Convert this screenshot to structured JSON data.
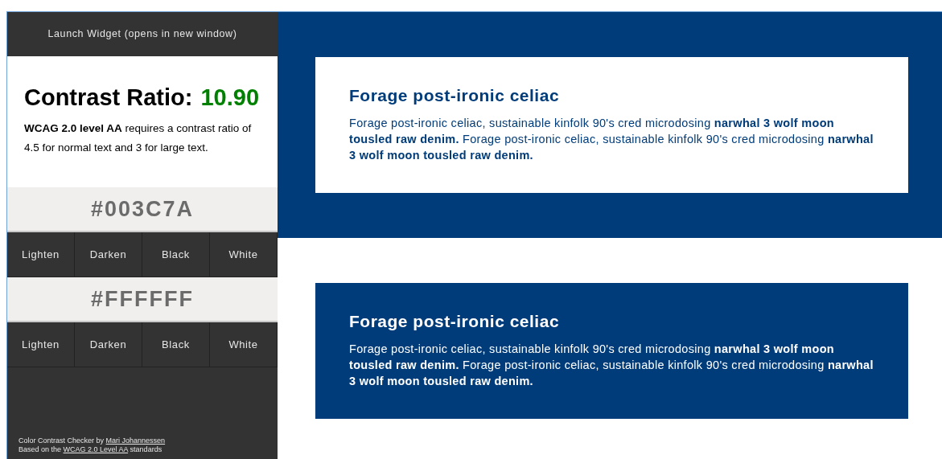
{
  "launch_button": "Launch Widget (opens in new window)",
  "ratio": {
    "label": "Contrast Ratio:",
    "value": "10.90"
  },
  "note": "**WCAG 2.0 level AA** requires a contrast ratio of 4.5 for normal text and 3 for large text.",
  "colors": [
    {
      "hex": "#003C7A",
      "buttons": [
        "Lighten",
        "Darken",
        "Black",
        "White"
      ]
    },
    {
      "hex": "#FFFFFF",
      "buttons": [
        "Lighten",
        "Darken",
        "Black",
        "White"
      ]
    }
  ],
  "footer": [
    {
      "before": "Color Contrast Checker by",
      "link": "Mari Johannessen"
    },
    {
      "before": "Based on the",
      "link": "WCAG 2.0 Level AA",
      "after": "standards"
    }
  ],
  "samples": [
    {
      "kind": "light",
      "heading": "Forage post-ironic celiac",
      "text": "Forage post-ironic celiac, sustainable kinfolk 90's cred microdosing **narwhal 3 wolf moon tousled raw denim.** Forage post-ironic celiac, sustainable kinfolk 90's cred microdosing **narwhal 3 wolf moon tousled raw denim.**"
    },
    {
      "kind": "dark",
      "heading": "Forage post-ironic celiac",
      "text": "Forage post-ironic celiac, sustainable kinfolk 90's cred microdosing **narwhal 3 wolf moon tousled raw denim.** Forage post-ironic celiac, sustainable kinfolk 90's cred microdosing **narwhal 3 wolf moon tousled raw denim.**"
    }
  ]
}
